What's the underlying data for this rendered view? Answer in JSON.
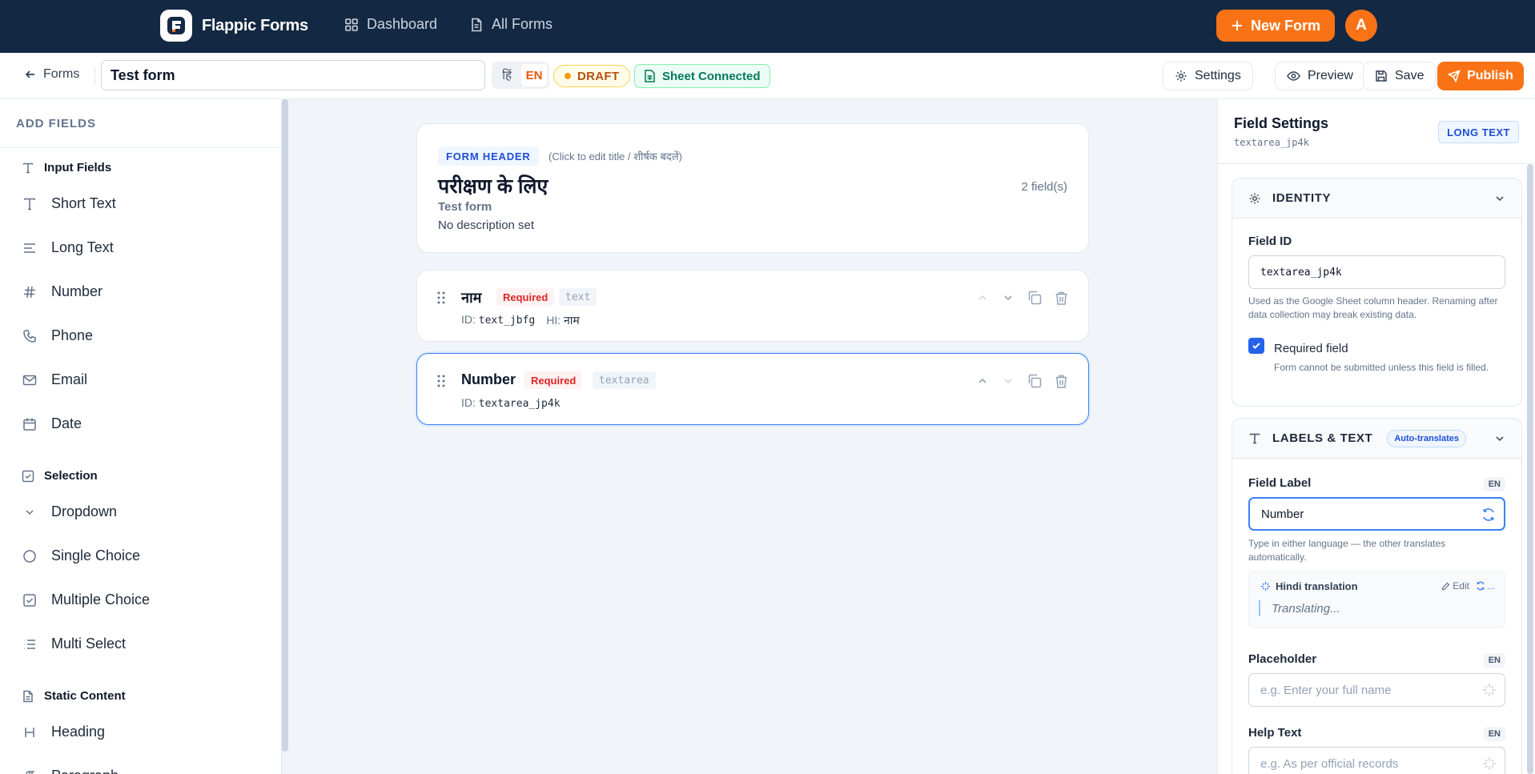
{
  "nav": {
    "brand": "Flappic Forms",
    "links": [
      {
        "label": "Dashboard",
        "icon": "grid-icon"
      },
      {
        "label": "All Forms",
        "icon": "document-icon"
      }
    ],
    "new_form_label": "New Form",
    "avatar_initial": "A"
  },
  "toolbar": {
    "back_label": "Forms",
    "form_title": "Test form",
    "lang_options": [
      "हिं",
      "EN"
    ],
    "lang_selected": "EN",
    "status": "DRAFT",
    "sheet_status": "Sheet Connected",
    "settings_label": "Settings",
    "preview_label": "Preview",
    "save_label": "Save",
    "publish_label": "Publish"
  },
  "sidebar": {
    "title": "ADD FIELDS",
    "groups": [
      {
        "label": "Input Fields",
        "icon": "type-icon",
        "items": [
          {
            "label": "Short Text",
            "icon": "type-icon"
          },
          {
            "label": "Long Text",
            "icon": "align-left-icon"
          },
          {
            "label": "Number",
            "icon": "hash-icon"
          },
          {
            "label": "Phone",
            "icon": "phone-icon"
          },
          {
            "label": "Email",
            "icon": "mail-icon"
          },
          {
            "label": "Date",
            "icon": "calendar-icon"
          }
        ]
      },
      {
        "label": "Selection",
        "icon": "check-square-icon",
        "items": [
          {
            "label": "Dropdown",
            "icon": "chevron-down-icon"
          },
          {
            "label": "Single Choice",
            "icon": "circle-icon"
          },
          {
            "label": "Multiple Choice",
            "icon": "check-square-icon"
          },
          {
            "label": "Multi Select",
            "icon": "list-icon"
          }
        ]
      },
      {
        "label": "Static Content",
        "icon": "file-text-icon",
        "items": [
          {
            "label": "Heading",
            "icon": "heading-icon"
          },
          {
            "label": "Paragraph",
            "icon": "paragraph-icon"
          }
        ]
      }
    ]
  },
  "form_header": {
    "tag": "FORM HEADER",
    "hint": "(Click to edit title / शीर्षक बदलें)",
    "title": "परीक्षण के लिए",
    "subtitle": "Test form",
    "description": "No description set",
    "field_count": "2 field(s)"
  },
  "fields": [
    {
      "label": "नाम",
      "required": "Required",
      "type": "text",
      "id_prefix": "ID:",
      "id": "text_jbfg",
      "hi_prefix": "HI:",
      "hi": "नाम",
      "selected": false
    },
    {
      "label": "Number",
      "required": "Required",
      "type": "textarea",
      "id_prefix": "ID:",
      "id": "textarea_jp4k",
      "selected": true
    }
  ],
  "field_settings": {
    "title": "Field Settings",
    "field_id": "textarea_jp4k",
    "type_badge": "LONG TEXT",
    "identity": {
      "title": "IDENTITY",
      "field_id_label": "Field ID",
      "field_id_value": "textarea_jp4k",
      "field_id_help": "Used as the Google Sheet column header. Renaming after data collection may break existing data.",
      "required_label": "Required field",
      "required_checked": true,
      "required_help": "Form cannot be submitted unless this field is filled."
    },
    "labels": {
      "title": "LABELS & TEXT",
      "auto_badge": "Auto-translates",
      "field_label": "Field Label",
      "lang_tag": "EN",
      "field_label_value": "Number",
      "field_label_help": "Type in either language — the other translates automatically.",
      "translation_title": "Hindi translation",
      "translation_edit": "Edit",
      "translation_more": "...",
      "translation_status": "Translating...",
      "placeholder_label": "Placeholder",
      "placeholder_placeholder": "e.g. Enter your full name",
      "help_label": "Help Text",
      "help_placeholder": "e.g. As per official records"
    }
  },
  "colors": {
    "nav_bg": "#132842",
    "accent": "#f97316",
    "primary": "#2563eb"
  }
}
